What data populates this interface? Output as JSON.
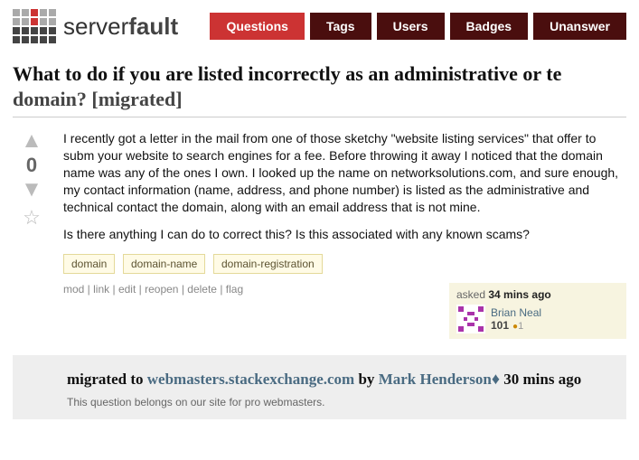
{
  "logo": {
    "part1": "server",
    "part2": "fault"
  },
  "nav": {
    "questions": "Questions",
    "tags": "Tags",
    "users": "Users",
    "badges": "Badges",
    "unanswered": "Unanswer"
  },
  "question": {
    "title": "What to do if you are listed incorrectly as an administrative or te",
    "title_suffix": "domain? [migrated]",
    "score": "0",
    "body_p1": "I recently got a letter in the mail from one of those sketchy \"website listing services\" that offer to subm your website to search engines for a fee. Before throwing it away I noticed that the domain name was any of the ones I own. I looked up the name on networksolutions.com, and sure enough, my contact information (name, address, and phone number) is listed as the administrative and technical contact the domain, along with an email address that is not mine.",
    "body_p2": "Is there anything I can do to correct this? Is this associated with any known scams?",
    "tags": [
      "domain",
      "domain-name",
      "domain-registration"
    ],
    "actions": {
      "mod": "mod",
      "link": "link",
      "edit": "edit",
      "reopen": "reopen",
      "delete": "delete",
      "flag": "flag"
    },
    "asked_label": "asked",
    "asked_time": "34 mins ago",
    "user": {
      "name": "Brian Neal",
      "rep": "101",
      "bronze": "1"
    }
  },
  "migrated": {
    "prefix": "migrated to ",
    "site": "webmasters.stackexchange.com",
    "by": " by ",
    "mod": "Mark Henderson",
    "time": " 30 mins ago",
    "desc": "This question belongs on our site for pro webmasters."
  }
}
